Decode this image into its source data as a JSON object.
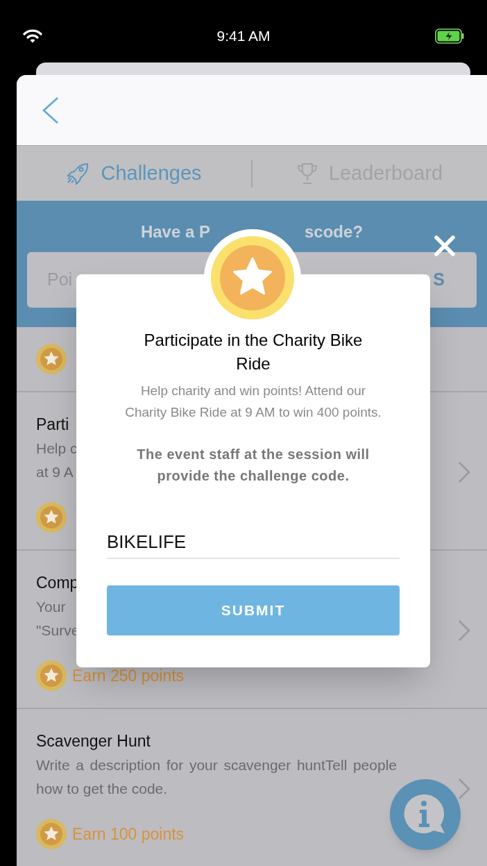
{
  "status_bar": {
    "time": "9:41 AM"
  },
  "tabs": [
    {
      "label": "Challenges",
      "selected": true
    },
    {
      "label": "Leaderboard",
      "selected": false
    }
  ],
  "passcode": {
    "heading_parts": [
      "Have a P",
      "scode?"
    ],
    "placeholder": "Poi",
    "button": "S"
  },
  "challenges": [
    {
      "kind": "reward"
    },
    {
      "kind": "challenge",
      "title": "Parti",
      "description": [
        "Help c",
        "at 9 A"
      ]
    },
    {
      "kind": "challenge",
      "title": "Comp",
      "description": [
        "Your",
        "\"Surve"
      ],
      "points": "Earn 250 points"
    },
    {
      "kind": "challenge",
      "title": "Scavenger Hunt",
      "description": [
        "Write a description for your scavenger huntTell people how to get the code."
      ],
      "points": "Earn 100 points"
    }
  ],
  "modal": {
    "title": "Participate in the Charity Bike Ride",
    "description": "Help charity and win points! Attend our Charity Bike Ride at 9 AM to win 400 points.",
    "instruction": "The event staff at the session will provide the challenge code.",
    "code_value": "BIKELIFE",
    "submit": "SUBMIT"
  }
}
